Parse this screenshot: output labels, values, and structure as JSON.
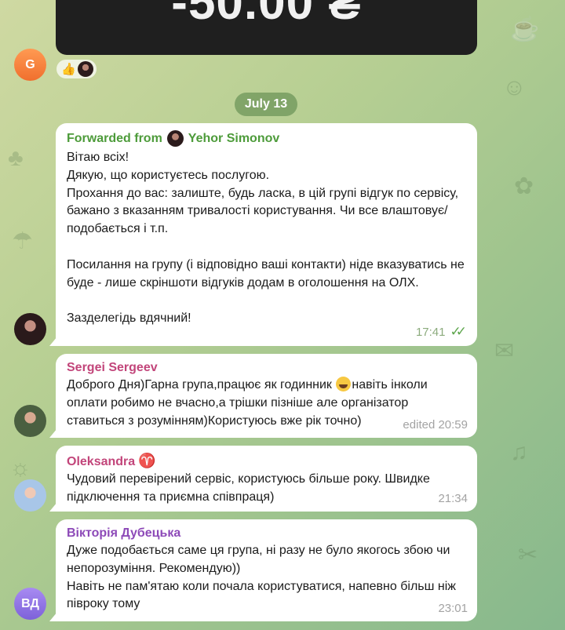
{
  "top_message": {
    "amount": "-50.00 ₴"
  },
  "avatars": {
    "g_initial": "G",
    "vd_initials": "ВД"
  },
  "reactions": {
    "emoji": "👍"
  },
  "date_separator": "July 13",
  "messages": [
    {
      "forwarded_prefix": "Forwarded from",
      "forwarded_name": "Yehor Simonov",
      "text": "Вітаю всіх!\nДякую, що користуєтесь послугою.\nПрохання до вас: залиште, будь ласка, в цій групі відгук по сервісу, бажано з вказанням тривалості користування. Чи все влаштовує/подобається і т.п.\n\nПосилання на групу (і відповідно ваші контакти) ніде вказуватись не буде - лише скріншоти відгуків додам в оголошення на ОЛХ.\n\nЗазделегідь вдячний!",
      "time": "17:41"
    },
    {
      "sender": "Sergei Sergeev",
      "text_before_emoji": "Доброго Дня)Гарна група,працює як годинник ",
      "text_after_emoji": "навіть інколи оплати робимо не вчасно,а трішки пізніше але організатор ставиться з розумінням)Користуюсь вже рік точно)",
      "time": "edited 20:59"
    },
    {
      "sender": "Oleksandra",
      "sender_symbol": "♈",
      "text": "Чудовий перевірений сервіс, користуюсь більше року. Швидке підключення та приємна співпраця)",
      "time": "21:34"
    },
    {
      "sender": "Вікторія Дубецька",
      "text": "Дуже подобається саме ця група, ні разу не було якогось збою чи непорозуміння. Рекомендую))\nНавіть не пам'ятаю коли почала користуватися, напевно більш ніж півроку тому",
      "time": "23:01"
    }
  ],
  "colors": {
    "forward_green": "#4d9b3a",
    "sender_pink": "#c2457a",
    "sender_purple": "#8d4ab8",
    "time_green": "#8cab7d",
    "check_green": "#5ea64d"
  }
}
